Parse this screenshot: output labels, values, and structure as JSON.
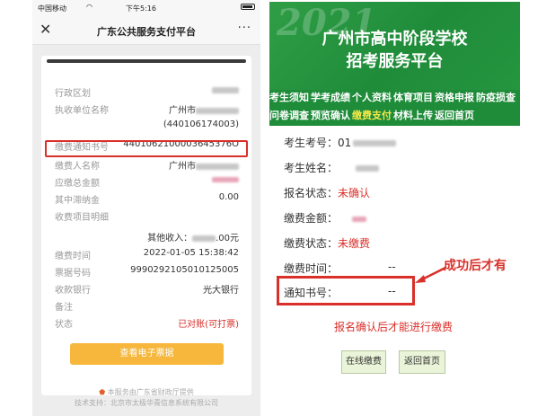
{
  "phone": {
    "status": {
      "carrier": "中国移动",
      "wifi": "WiFi",
      "time": "下午5:16"
    },
    "nav": {
      "close": "✕",
      "title": "广东公共服务支付平台",
      "more": "···"
    },
    "rows": [
      {
        "label": "行政区划",
        "value": ""
      },
      {
        "label": "执收单位名称",
        "value": "广州市"
      },
      {
        "label": "",
        "value": "(440106174003)"
      },
      {
        "label": "缴费通知书号",
        "value": "4401062100003645376O"
      },
      {
        "label": "缴费人名称",
        "value": "广州市"
      },
      {
        "label": "应缴总金额",
        "value": ""
      },
      {
        "label": "其中滞纳金",
        "value": "0.00"
      },
      {
        "label": "收费项目明细",
        "value": ""
      },
      {
        "label": "",
        "value": "其他收入："
      },
      {
        "label": "缴费时间",
        "value": "2022-01-05 15:38:42"
      },
      {
        "label": "票据号码",
        "value": "9990292105010125005"
      },
      {
        "label": "收款银行",
        "value": "光大银行"
      },
      {
        "label": "备注",
        "value": ""
      },
      {
        "label": "状态",
        "value": "已对账(可打票)"
      }
    ],
    "amount_suffix": ".00元",
    "receipt_button": "查看电子票据",
    "footer_line1": "本服务由广东省财政厅提供",
    "footer_line2": "技术支持：北京市太极华青信息系统有限公司"
  },
  "web": {
    "banner": {
      "year": "2021",
      "title1": "广州市高中阶段学校",
      "title2": "招考服务平台"
    },
    "nav_row1": [
      "考生须知",
      "学考成绩",
      "个人资料",
      "体育项目",
      "资格申报",
      "防疫损查"
    ],
    "nav_row2": [
      "问卷调查",
      "预览确认",
      "缴费支付",
      "材料上传",
      "返回首页"
    ],
    "active_nav": "缴费支付",
    "fields": {
      "exam_no_label": "考生考号：",
      "exam_no_value": "01",
      "name_label": "考生姓名：",
      "name_value": "",
      "reg_status_label": "报名状态：",
      "reg_status_value": "未确认",
      "fee_amount_label": "缴费金额：",
      "fee_amount_value": "",
      "fee_status_label": "缴费状态：",
      "fee_status_value": "未缴费",
      "fee_time_label": "缴费时间：",
      "fee_time_value": "--",
      "notice_no_label": "通知书号：",
      "notice_no_value": "--"
    },
    "annotation_success": "成功后才有",
    "annotation_confirm": "报名确认后才能进行缴费",
    "button_online_pay": "在线缴费",
    "button_home": "返回首页"
  },
  "colors": {
    "accent_red": "#d9302a",
    "banner_green": "#1f8c3a",
    "button_orange": "#f6b73c",
    "nav_active": "#f5e94a"
  }
}
